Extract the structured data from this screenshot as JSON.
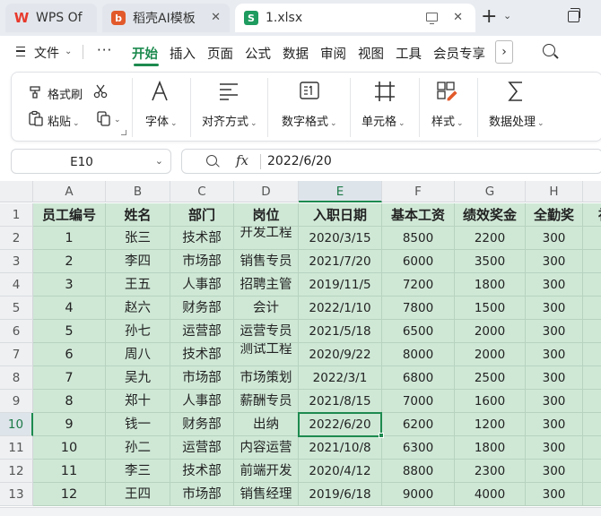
{
  "tabs": [
    {
      "label": "WPS Of",
      "kind": "wps"
    },
    {
      "label": "稻壳AI模板",
      "kind": "ai"
    },
    {
      "label": "1.xlsx",
      "kind": "file",
      "active": true
    }
  ],
  "tab_icons": {
    "wps": "W",
    "ai": "b",
    "file": "S"
  },
  "menu": {
    "file_label": "文件",
    "more_label": "···",
    "items": [
      "开始",
      "插入",
      "页面",
      "公式",
      "数据",
      "审阅",
      "视图",
      "工具",
      "会员专享"
    ],
    "active_index": 0
  },
  "ribbon": {
    "format_painter": "格式刷",
    "paste": "粘贴",
    "font": "字体",
    "alignment": "对齐方式",
    "number_format": "数字格式",
    "cells": "单元格",
    "styles": "样式",
    "data_processing": "数据处理"
  },
  "formula_bar": {
    "name_box": "E10",
    "fx": "fx",
    "value": "2022/6/20"
  },
  "grid": {
    "columns": [
      "A",
      "B",
      "C",
      "D",
      "E",
      "F",
      "G",
      "H"
    ],
    "rows": [
      "1",
      "2",
      "3",
      "4",
      "5",
      "6",
      "7",
      "8",
      "9",
      "10",
      "11",
      "12",
      "13"
    ],
    "selected_column": "E",
    "selected_row": "10",
    "header_row": [
      "员工编号",
      "姓名",
      "部门",
      "岗位",
      "入职日期",
      "基本工资",
      "绩效奖金",
      "全勤奖",
      "社"
    ],
    "data_rows": [
      [
        "1",
        "张三",
        "技术部",
        "开发工程",
        "2020/3/15",
        "8500",
        "2200",
        "300"
      ],
      [
        "2",
        "李四",
        "市场部",
        "销售专员",
        "2021/7/20",
        "6000",
        "3500",
        "300"
      ],
      [
        "3",
        "王五",
        "人事部",
        "招聘主管",
        "2019/11/5",
        "7200",
        "1800",
        "300"
      ],
      [
        "4",
        "赵六",
        "财务部",
        "会计",
        "2022/1/10",
        "7800",
        "1500",
        "300"
      ],
      [
        "5",
        "孙七",
        "运营部",
        "运营专员",
        "2021/5/18",
        "6500",
        "2000",
        "300"
      ],
      [
        "6",
        "周八",
        "技术部",
        "测试工程",
        "2020/9/22",
        "8000",
        "2000",
        "300"
      ],
      [
        "7",
        "吴九",
        "市场部",
        "市场策划",
        "2022/3/1",
        "6800",
        "2500",
        "300"
      ],
      [
        "8",
        "郑十",
        "人事部",
        "薪酬专员",
        "2021/8/15",
        "7000",
        "1600",
        "300"
      ],
      [
        "9",
        "钱一",
        "财务部",
        "出纳",
        "2022/6/20",
        "6200",
        "1200",
        "300"
      ],
      [
        "10",
        "孙二",
        "运营部",
        "内容运营",
        "2021/10/8",
        "6300",
        "1800",
        "300"
      ],
      [
        "11",
        "李三",
        "技术部",
        "前端开发",
        "2020/4/12",
        "8800",
        "2300",
        "300"
      ],
      [
        "12",
        "王四",
        "市场部",
        "销售经理",
        "2019/6/18",
        "9000",
        "4000",
        "300"
      ]
    ]
  },
  "colors": {
    "accent": "#1d8a4f",
    "cell_fill": "#cfe8d6",
    "header_bg": "#eef0f2"
  }
}
